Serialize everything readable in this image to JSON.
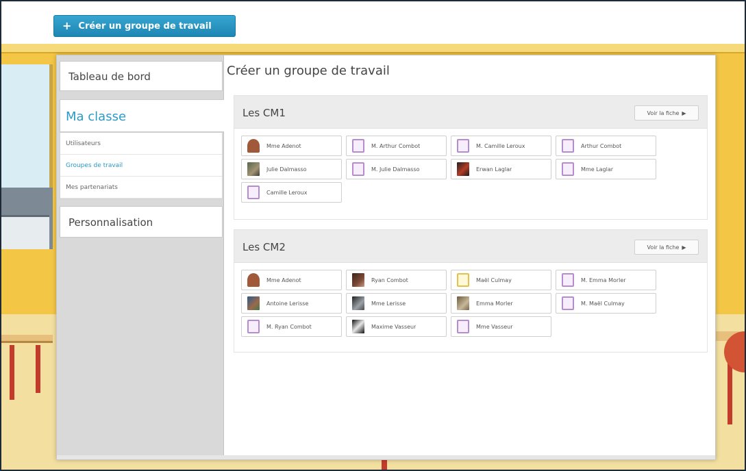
{
  "toolbar": {
    "create_button": "Créer un groupe de travail",
    "create_icon": "plus-icon"
  },
  "sidebar": {
    "dashboard": "Tableau de bord",
    "classe": "Ma classe",
    "sub_items": [
      {
        "label": "Utilisateurs"
      },
      {
        "label": "Groupes de travail"
      },
      {
        "label": "Mes partenariats"
      }
    ],
    "personnalisation": "Personnalisation"
  },
  "main": {
    "title": "Créer un groupe de travail",
    "groups": [
      {
        "name": "Les CM1",
        "fiche_label": "Voir la fiche",
        "members": [
          {
            "name": "Mme Adenot",
            "avatar": "girl"
          },
          {
            "name": "M. Arthur Combot",
            "avatar": "default"
          },
          {
            "name": "M. Camille Leroux",
            "avatar": "default"
          },
          {
            "name": "Arthur Combot",
            "avatar": "default"
          },
          {
            "name": "Julie Dalmasso",
            "avatar": "photo-1"
          },
          {
            "name": "M. Julie Dalmasso",
            "avatar": "default"
          },
          {
            "name": "Erwan Laglar",
            "avatar": "photo-2"
          },
          {
            "name": "Mme Laglar",
            "avatar": "default"
          },
          {
            "name": "Camille Leroux",
            "avatar": "default"
          }
        ]
      },
      {
        "name": "Les CM2",
        "fiche_label": "Voir la fiche",
        "members": [
          {
            "name": "Mme Adenot",
            "avatar": "girl"
          },
          {
            "name": "Ryan Combot",
            "avatar": "photo-3"
          },
          {
            "name": "Maël Culmay",
            "avatar": "default-y"
          },
          {
            "name": "M. Emma Morler",
            "avatar": "default"
          },
          {
            "name": "Antoine Lerisse",
            "avatar": "photo-4"
          },
          {
            "name": "Mme Lerisse",
            "avatar": "photo-5"
          },
          {
            "name": "Emma Morler",
            "avatar": "photo-6"
          },
          {
            "name": "M. Maël Culmay",
            "avatar": "default"
          },
          {
            "name": "M. Ryan Combot",
            "avatar": "default"
          },
          {
            "name": "Maxime Vasseur",
            "avatar": "photo-7"
          },
          {
            "name": "Mme Vasseur",
            "avatar": "default"
          }
        ]
      }
    ]
  }
}
